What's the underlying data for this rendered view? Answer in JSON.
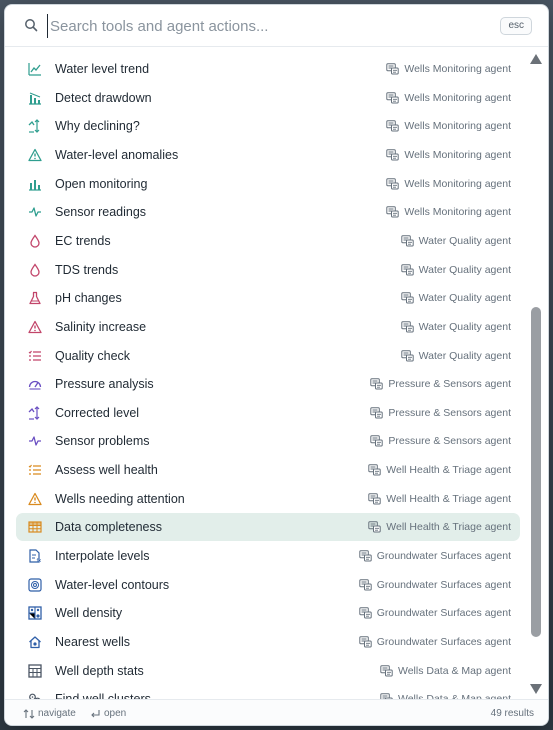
{
  "search": {
    "placeholder": "Search tools and agent actions...",
    "esc_label": "esc"
  },
  "colors": {
    "wells": "#2f9e8f",
    "quality": "#c2456a",
    "pressure": "#6a4fc2",
    "health": "#d98a1e",
    "surfaces": "#2f5fa8",
    "mapagent": "#4a5563",
    "selected_bg": "#e2eeea"
  },
  "items": [
    {
      "label": "Water level trend",
      "agent": "Wells Monitoring agent",
      "icon": "line-chart-icon",
      "group": "wells"
    },
    {
      "label": "Detect drawdown",
      "agent": "Wells Monitoring agent",
      "icon": "bar-chart-down-icon",
      "group": "wells"
    },
    {
      "label": "Why declining?",
      "agent": "Wells Monitoring agent",
      "icon": "trend-level-icon",
      "group": "wells"
    },
    {
      "label": "Water-level anomalies",
      "agent": "Wells Monitoring agent",
      "icon": "warning-triangle-icon",
      "group": "wells"
    },
    {
      "label": "Open monitoring",
      "agent": "Wells Monitoring agent",
      "icon": "bar-chart-icon",
      "group": "wells"
    },
    {
      "label": "Sensor readings",
      "agent": "Wells Monitoring agent",
      "icon": "pulse-icon",
      "group": "wells"
    },
    {
      "label": "EC trends",
      "agent": "Water Quality agent",
      "icon": "droplet-icon",
      "group": "quality"
    },
    {
      "label": "TDS trends",
      "agent": "Water Quality agent",
      "icon": "droplet-icon",
      "group": "quality"
    },
    {
      "label": "pH changes",
      "agent": "Water Quality agent",
      "icon": "flask-icon",
      "group": "quality"
    },
    {
      "label": "Salinity increase",
      "agent": "Water Quality agent",
      "icon": "warning-triangle-icon",
      "group": "quality"
    },
    {
      "label": "Quality check",
      "agent": "Water Quality agent",
      "icon": "checklist-icon",
      "group": "quality"
    },
    {
      "label": "Pressure analysis",
      "agent": "Pressure & Sensors agent",
      "icon": "gauge-icon",
      "group": "pressure"
    },
    {
      "label": "Corrected level",
      "agent": "Pressure & Sensors agent",
      "icon": "trend-level-icon",
      "group": "pressure"
    },
    {
      "label": "Sensor problems",
      "agent": "Pressure & Sensors agent",
      "icon": "pulse-icon",
      "group": "pressure"
    },
    {
      "label": "Assess well health",
      "agent": "Well Health & Triage agent",
      "icon": "checklist-icon",
      "group": "health"
    },
    {
      "label": "Wells needing attention",
      "agent": "Well Health & Triage agent",
      "icon": "warning-triangle-icon",
      "group": "health"
    },
    {
      "label": "Data completeness",
      "agent": "Well Health & Triage agent",
      "icon": "table-grid-icon",
      "group": "health",
      "selected": true
    },
    {
      "label": "Interpolate levels",
      "agent": "Groundwater Surfaces agent",
      "icon": "interpolate-icon",
      "group": "surfaces"
    },
    {
      "label": "Water-level contours",
      "agent": "Groundwater Surfaces agent",
      "icon": "contour-icon",
      "group": "surfaces"
    },
    {
      "label": "Well density",
      "agent": "Groundwater Surfaces agent",
      "icon": "density-map-icon",
      "group": "surfaces"
    },
    {
      "label": "Nearest wells",
      "agent": "Groundwater Surfaces agent",
      "icon": "nearest-house-icon",
      "group": "surfaces"
    },
    {
      "label": "Well depth stats",
      "agent": "Wells Data & Map agent",
      "icon": "stats-grid-icon",
      "group": "mapagent"
    },
    {
      "label": "Find well clusters",
      "agent": "Wells Data & Map agent",
      "icon": "clusters-icon",
      "group": "mapagent"
    }
  ],
  "footer": {
    "navigate": "navigate",
    "open": "open",
    "results": "49 results"
  }
}
